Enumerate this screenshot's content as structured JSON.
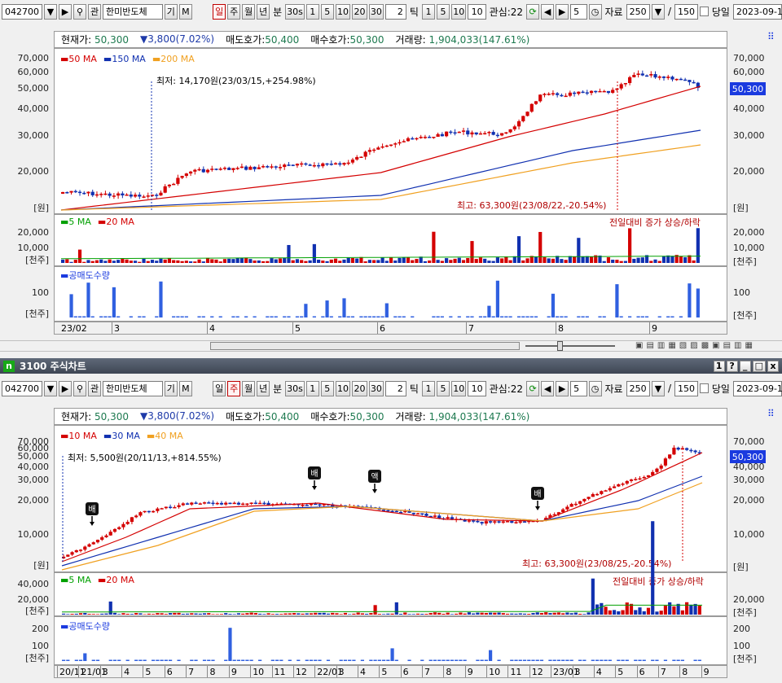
{
  "toolbar": {
    "code": "042700",
    "search_icon": "magnifier",
    "kwan": "관",
    "name": "한미반도체",
    "gi": "기",
    "m": "M",
    "period_tabs": [
      "일",
      "주",
      "월",
      "년"
    ],
    "minute_label": "분",
    "minute_values": [
      "30s",
      "1",
      "5",
      "10",
      "20",
      "30"
    ],
    "tick_input": "2",
    "tick_label": "틱",
    "tick_values": [
      "1",
      "5",
      "10"
    ],
    "tick_input2": "10",
    "gwansim": "관심:22",
    "count_input": "5",
    "jaryo_label": "자료",
    "jaryo_value": "250",
    "slash": "/",
    "total_value": "150",
    "dangil_label": "당일",
    "date": "2023-09-1"
  },
  "info": {
    "cur_label": "현재가:",
    "cur_value": "50,300",
    "change": "3,800(7.02%)",
    "ask_label": "매도호가:",
    "ask_value": "50,400",
    "bid_label": "매수호가:",
    "bid_value": "50,300",
    "vol_label": "거래량:",
    "vol_value": "1,904,033(147.61%)"
  },
  "top": {
    "legend": [
      {
        "label": "50 MA",
        "color": "#d40000"
      },
      {
        "label": "150 MA",
        "color": "#1030b0"
      },
      {
        "label": "200 MA",
        "color": "#f0a020"
      }
    ],
    "low_text": "최저: 14,170원(23/03/15,+254.98%)",
    "high_text": "최고: 63,300원(23/08/22,-20.54%)",
    "y_ticks": [
      "70,000",
      "60,000",
      "50,000",
      "40,000",
      "30,000",
      "20,000"
    ],
    "unit": "[원]",
    "vol_legend": [
      {
        "label": "5 MA",
        "color": "#00a000"
      },
      {
        "label": "20 MA",
        "color": "#d40000"
      }
    ],
    "vol_note": "전일대비 증가 상승/하락",
    "vol_ticks": [
      "20,000",
      "10,000"
    ],
    "vol_unit": "[천주]",
    "short_label": "공매도수량",
    "short_ticks": [
      "100"
    ],
    "short_unit": "[천주]",
    "x_labels": [
      "23/02",
      "3",
      "4",
      "5",
      "6",
      "7",
      "8",
      "9"
    ],
    "price_badge": "50,300"
  },
  "window": {
    "icon": "n",
    "title": "3100 주식차트",
    "ctrl_buttons": [
      "1",
      "?",
      "_",
      "□",
      "x"
    ]
  },
  "bottom": {
    "legend": [
      {
        "label": "10 MA",
        "color": "#d40000"
      },
      {
        "label": "30 MA",
        "color": "#1030b0"
      },
      {
        "label": "40 MA",
        "color": "#f0a020"
      }
    ],
    "low_text": "최저: 5,500원(20/11/13,+814.55%)",
    "high_text": "최고: 63,300원(23/08/25,-20.54%)",
    "y_ticks": [
      "70,000",
      "60,000",
      "50,000",
      "40,000",
      "30,000",
      "20,000",
      "10,000"
    ],
    "unit": "[원]",
    "markers": [
      "배",
      "배",
      "액",
      "배"
    ],
    "vol_legend": [
      {
        "label": "5 MA",
        "color": "#00a000"
      },
      {
        "label": "20 MA",
        "color": "#d40000"
      }
    ],
    "vol_note": "전일대비 증가 상승/하락",
    "vol_ticks": [
      "40,000",
      "20,000"
    ],
    "vol_unit": "[천주]",
    "short_label": "공매도수량",
    "short_ticks": [
      "200",
      "100"
    ],
    "short_unit": "[천주]",
    "x_labels": [
      "20/11",
      "21/01",
      "3",
      "4",
      "5",
      "6",
      "7",
      "8",
      "9",
      "10",
      "11",
      "12",
      "22/01",
      "3",
      "4",
      "5",
      "6",
      "7",
      "8",
      "9",
      "10",
      "11",
      "12",
      "23/01",
      "3",
      "4",
      "5",
      "6",
      "7",
      "8",
      "9"
    ],
    "price_badge": "50,300"
  }
}
